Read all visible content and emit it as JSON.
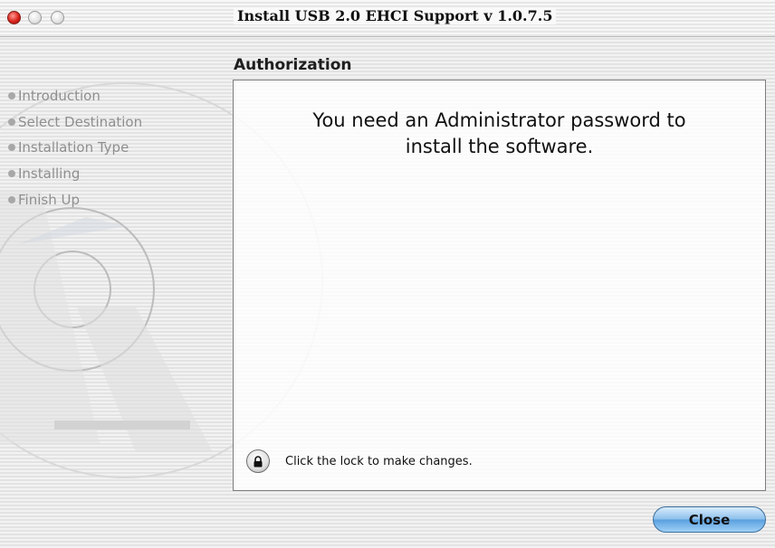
{
  "window": {
    "title": "Install USB 2.0 EHCI Support v 1.0.7.5"
  },
  "steps": [
    {
      "label": "Introduction"
    },
    {
      "label": "Select Destination"
    },
    {
      "label": "Installation Type"
    },
    {
      "label": "Installing"
    },
    {
      "label": "Finish Up"
    }
  ],
  "main": {
    "section_title": "Authorization",
    "message_line1": "You need an Administrator password to",
    "message_line2": "install the software.",
    "lock_label": "Click the lock to make changes."
  },
  "buttons": {
    "close_label": "Close"
  },
  "icons": {
    "lock": "lock-icon",
    "watermark": "mac-os-x-logo"
  },
  "colors": {
    "close_light": "#d7281f",
    "accent_button": "#6aaee8"
  }
}
